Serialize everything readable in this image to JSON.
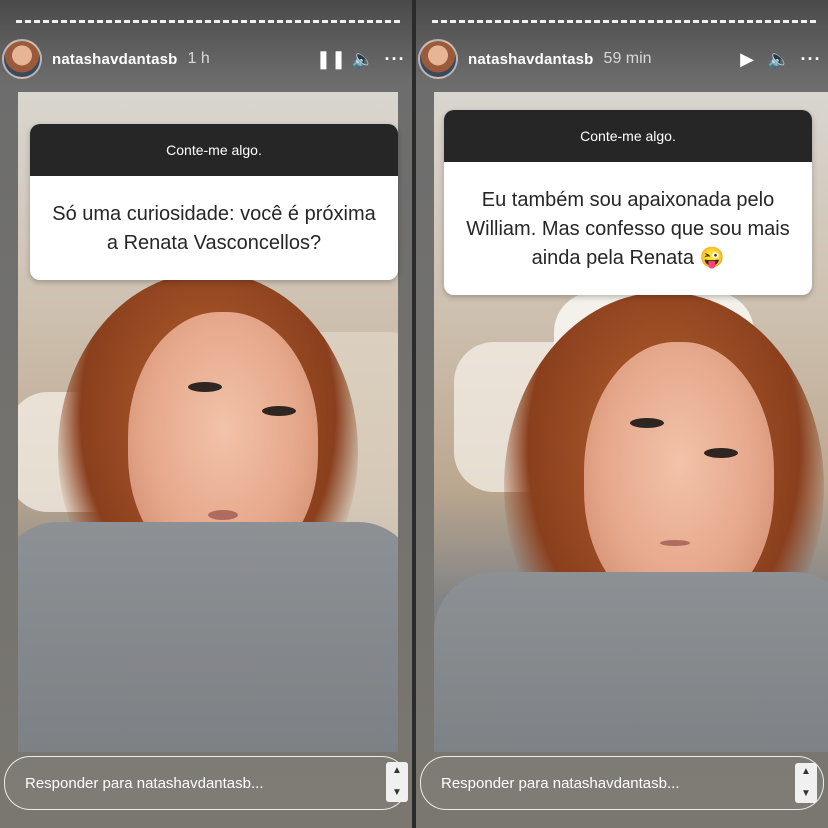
{
  "stories": [
    {
      "username": "natashavdantasb",
      "time": "1 h",
      "question_header": "Conte-me algo.",
      "answer": "Só uma curiosidade: você é próxima a Renata Vasconcellos?",
      "reply_placeholder": "Responder para natashavdantasb...",
      "playback": "pause"
    },
    {
      "username": "natashavdantasb",
      "time": "59 min",
      "question_header": "Conte-me algo.",
      "answer": "Eu também sou apaixonada pelo William. Mas confesso que sou mais ainda pela Renata 😜",
      "reply_placeholder": "Responder para natashavdantasb...",
      "playback": "play"
    }
  ],
  "icons": {
    "pause": "pause-icon",
    "play": "play-icon",
    "volume": "volume-icon",
    "more": "more-options-icon"
  },
  "glyphs": {
    "pause": "❚❚",
    "play": "▶",
    "volume": "🔈",
    "more": "···"
  }
}
